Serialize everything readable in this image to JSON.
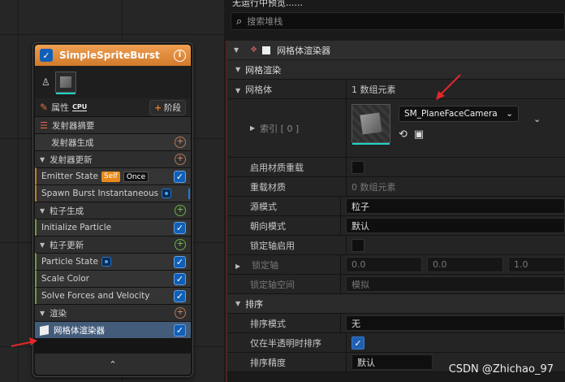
{
  "node": {
    "title": "SimpleSpriteBurst",
    "tabs": {
      "properties": "属性",
      "cpu": "CPU",
      "stage": "阶段"
    },
    "rows": [
      {
        "kind": "sec-list",
        "label": "发射器摘要"
      },
      {
        "kind": "plain",
        "label": "发射器生成"
      },
      {
        "kind": "section",
        "label": "发射器更新"
      },
      {
        "kind": "item",
        "label": "Emitter State"
      },
      {
        "kind": "item",
        "label": "Spawn Burst Instantaneous"
      },
      {
        "kind": "section",
        "label": "粒子生成"
      },
      {
        "kind": "item",
        "label": "Initialize Particle"
      },
      {
        "kind": "section",
        "label": "粒子更新"
      },
      {
        "kind": "item",
        "label": "Particle State"
      },
      {
        "kind": "item",
        "label": "Scale Color"
      },
      {
        "kind": "item",
        "label": "Solve Forces and Velocity"
      },
      {
        "kind": "section",
        "label": "渲染"
      },
      {
        "kind": "item",
        "label": "网格体渲染器"
      }
    ],
    "badges": {
      "self": "Self",
      "once": "Once"
    }
  },
  "panel": {
    "topbar": "无运行中预览......",
    "search_placeholder": "搜索堆栈",
    "header": "网格体渲染器",
    "mesh_render": "网格渲染",
    "mesh_label": "网格体",
    "mesh_count": "1 数组元素",
    "index_label": "索引 [ 0 ]",
    "mesh_value": "SM_PlaneFaceCamera",
    "props": [
      {
        "name": "启用材质重载",
        "type": "check",
        "on": false
      },
      {
        "name": "重载材质",
        "type": "text",
        "value": "0 数组元素"
      },
      {
        "name": "源模式",
        "type": "box",
        "value": "粒子"
      },
      {
        "name": "朝向模式",
        "type": "box",
        "value": "默认"
      },
      {
        "name": "锁定轴启用",
        "type": "check",
        "on": false
      }
    ],
    "lock_axis": {
      "name": "锁定轴",
      "x": "0.0",
      "y": "0.0",
      "z": "1.0"
    },
    "lock_space": {
      "name": "锁定轴空间",
      "value": "模拟"
    },
    "sort": "排序",
    "sort_props": [
      {
        "name": "排序模式",
        "type": "box",
        "value": "无"
      },
      {
        "name": "仅在半透明时排序",
        "type": "check",
        "on": true
      },
      {
        "name": "排序精度",
        "type": "box",
        "value": "默认"
      }
    ]
  },
  "watermark": "CSDN @Zhichao_97",
  "colors": {
    "header_orange": "#e08d3c",
    "check_blue": "#1f5fb0",
    "selected": "#435c7a",
    "arrow_red": "#e0282a"
  }
}
